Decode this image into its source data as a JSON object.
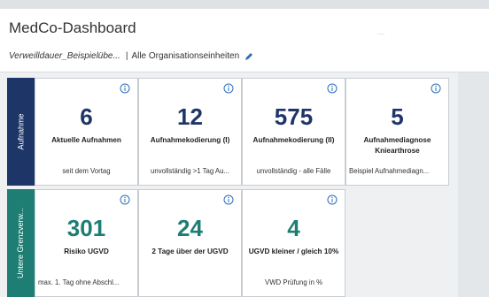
{
  "header": {
    "title": "MedCo-Dashboard",
    "report_name": "Verweilldauer_Beispielübe...",
    "separator": "|",
    "scope": "Alle Organisationseinheiten",
    "edit_icon": "pencil-icon"
  },
  "groups": [
    {
      "label": "Aufnahme",
      "color": "#1e3568",
      "tiles": [
        {
          "value": "6",
          "label": "Aktuelle Aufnahmen",
          "sub": "seit dem Vortag",
          "icon": "info-icon"
        },
        {
          "value": "12",
          "label": "Aufnahmekodierung (I)",
          "sub": "unvollständig >1 Tag Au...",
          "icon": "info-icon"
        },
        {
          "value": "575",
          "label": "Aufnahmekodierung (II)",
          "sub": "unvollständig - alle Fälle",
          "icon": "info-icon"
        },
        {
          "value": "5",
          "label": "Aufnahmediagnose Kniearthrose",
          "sub": "Beispiel Aufnahmediagn...",
          "icon": "info-icon"
        }
      ]
    },
    {
      "label": "Untere Grenzverw...",
      "color": "#1e7e73",
      "tiles": [
        {
          "value": "301",
          "label": "Risiko UGVD",
          "sub": "max. 1. Tag ohne Abschl...",
          "icon": "info-icon"
        },
        {
          "value": "24",
          "label": "2 Tage über der UGVD",
          "sub": "",
          "icon": "info-icon"
        },
        {
          "value": "4",
          "label": "UGVD kleiner / gleich 10%",
          "sub": "VWD Prüfung in %",
          "icon": "info-icon"
        }
      ]
    }
  ],
  "accent_colors": {
    "blue": "#1e3568",
    "green": "#1e7e73"
  }
}
